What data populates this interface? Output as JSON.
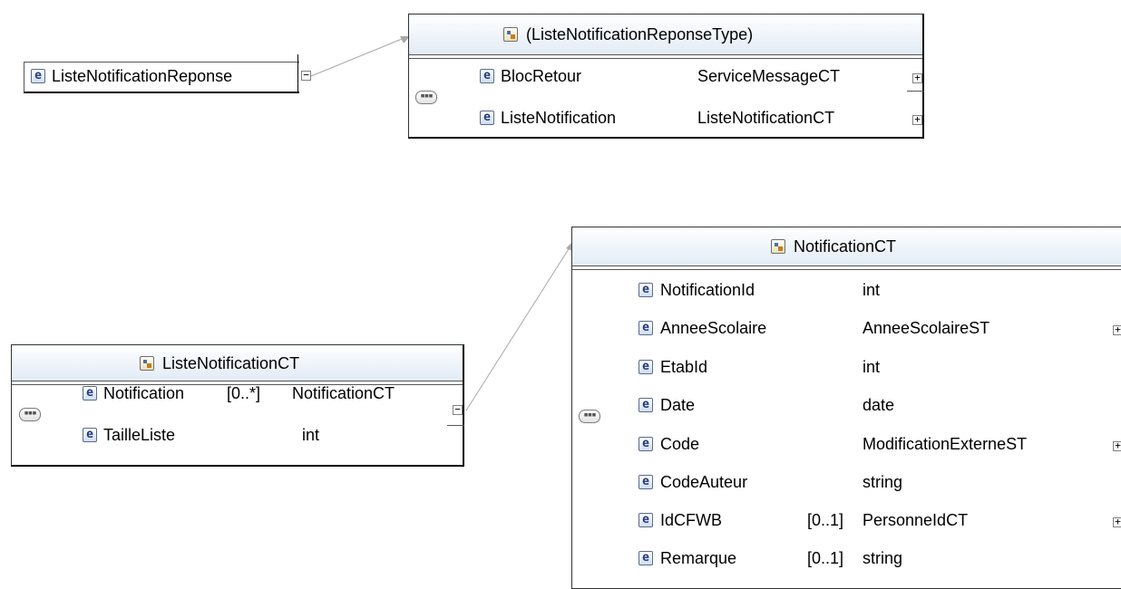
{
  "root_element": {
    "name": "ListeNotificationReponse",
    "icon": "element-icon",
    "expander": "−"
  },
  "reponse_type": {
    "title": "(ListeNotificationReponseType)",
    "compositor": "sequence-icon",
    "rows": [
      {
        "name": "BlocRetour",
        "type": "ServiceMessageCT",
        "expander": "+"
      },
      {
        "name": "ListeNotification",
        "type": "ListeNotificationCT",
        "expander": "+"
      }
    ]
  },
  "liste_ct": {
    "title": "ListeNotificationCT",
    "compositor": "sequence-icon",
    "rows": [
      {
        "name": "Notification",
        "occurs": "[0..*]",
        "type": "NotificationCT",
        "expander": "−"
      },
      {
        "name": "TailleListe",
        "occurs": "",
        "type": "int",
        "expander": ""
      }
    ]
  },
  "notification_ct": {
    "title": "NotificationCT",
    "compositor": "sequence-icon",
    "rows": [
      {
        "name": "NotificationId",
        "occurs": "",
        "type": "int",
        "expander": ""
      },
      {
        "name": "AnneeScolaire",
        "occurs": "",
        "type": "AnneeScolaireST",
        "expander": "+"
      },
      {
        "name": "EtabId",
        "occurs": "",
        "type": "int",
        "expander": ""
      },
      {
        "name": "Date",
        "occurs": "",
        "type": "date",
        "expander": ""
      },
      {
        "name": "Code",
        "occurs": "",
        "type": "ModificationExterneST",
        "expander": "+"
      },
      {
        "name": "CodeAuteur",
        "occurs": "",
        "type": "string",
        "expander": ""
      },
      {
        "name": "IdCFWB",
        "occurs": "[0..1]",
        "type": "PersonneIdCT",
        "expander": "+"
      },
      {
        "name": "Remarque",
        "occurs": "[0..1]",
        "type": "string",
        "expander": ""
      }
    ]
  }
}
